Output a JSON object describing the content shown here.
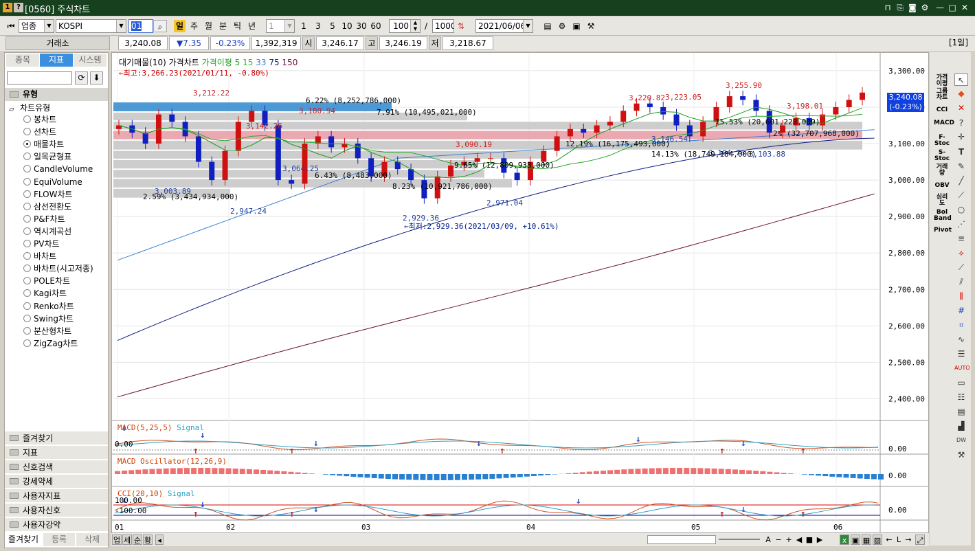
{
  "window": {
    "icon1": "1",
    "icon2": "?",
    "title": "[0560] 주식차트"
  },
  "toolbar": {
    "market_type": "업종",
    "index_name": "KOSPI",
    "code": "01",
    "periods": [
      "일",
      "주",
      "월",
      "분",
      "틱",
      "년"
    ],
    "interval": "1",
    "quick_intervals": [
      "1",
      "3",
      "5",
      "10",
      "30",
      "60"
    ],
    "count": "100",
    "count_sep": "/",
    "total": "1000",
    "date": "2021/06/06"
  },
  "quote": {
    "exchange_btn": "거래소",
    "price": "3,240.08",
    "change": "▼7.35",
    "change_pct": "-0.23%",
    "volume": "1,392,319",
    "open_label": "시",
    "open": "3,246.17",
    "high_label": "고",
    "high": "3,246.19",
    "low_label": "저",
    "low": "3,218.67",
    "period_tag": "[1일]"
  },
  "sidebar": {
    "tabs": [
      "종목",
      "지표",
      "시스템"
    ],
    "section": "유형",
    "tree_root": "차트유형",
    "chart_types": [
      "봉차트",
      "선차트",
      "매물차트",
      "일목균형표",
      "CandleVolume",
      "EquiVolume",
      "FLOW차트",
      "삼선전환도",
      "P&F차트",
      "역시계곡선",
      "PV차트",
      "바차트",
      "바차트(시고저종)",
      "POLE차트",
      "Kagi차트",
      "Renko차트",
      "Swing차트",
      "분산형차트",
      "ZigZag차트"
    ],
    "selected_type": "매물차트",
    "folders": [
      "즐겨찾기",
      "지표",
      "신호검색",
      "강세약세",
      "사용자지표",
      "사용자신호",
      "사용자강약"
    ],
    "bottom_tabs": [
      "즐겨찾기",
      "등록",
      "삭제"
    ]
  },
  "chart": {
    "legend": [
      "대기매물(10)",
      "가격차트",
      "가격이평",
      "5",
      "15",
      "33",
      "75",
      "150"
    ],
    "max_note": "←최고:3,266.23(2021/01/11, -0.80%)",
    "min_note": "←최저:2,929.36(2021/03/09, +10.61%)",
    "y_ticks": [
      "3,300.00",
      "3,200.00",
      "3,100.00",
      "3,000.00",
      "2,900.00",
      "2,800.00",
      "2,700.00",
      "2,600.00",
      "2,500.00",
      "2,400.00"
    ],
    "last_price_tag": "3,240.08",
    "last_change_tag": "(-0.23%)",
    "x_ticks": [
      "01",
      "02",
      "03",
      "04",
      "05",
      "06"
    ],
    "price_labels": [
      "3,212.22",
      "3,180.94",
      "3,142.26",
      "3,090.19",
      "3,220.82",
      "3,223.05",
      "3,255.90",
      "3,198.01",
      "3,064.25",
      "3,003.89",
      "2,947.24",
      "2,929.36",
      "2,971.04",
      "3,146.54",
      "3,103.88",
      "3,104.76"
    ],
    "volume_labels": [
      "6.22% (8,252,786,000)",
      "7.91% (10,495,021,000)",
      "12.19% (16,175,493,000)",
      "14.13% (18,749,184,000)",
      "15.53% (20,601,228,000)",
      "2% (32,707,968,000)",
      "6.43% (8,483,000)",
      "8.23% (10,921,786,000)",
      "9.65% (12,809,933,000)",
      "2.59% (3,434,934,000)"
    ],
    "macd_title": "MACD(5,25,5)",
    "macd_signal": "Signal",
    "macd_zero": "0.00",
    "macd_axis": "0.00",
    "osc_title": "MACD Oscillator(12,26,9)",
    "osc_axis": "0.00",
    "cci_title": "CCI(20,10)",
    "cci_signal": "Signal",
    "cci_100": "100.00",
    "cci_m100": "-100.00",
    "cci_axis": "0.00"
  },
  "chart_data": {
    "type": "candlestick",
    "title": "",
    "ylim": [
      2350,
      3330
    ],
    "x_months": [
      "01",
      "02",
      "03",
      "04",
      "05",
      "06"
    ],
    "series": [
      {
        "name": "가격차트",
        "approx_close": [
          3150,
          3130,
          3100,
          3180,
          3160,
          3120,
          3050,
          3000,
          3080,
          3160,
          3190,
          3150,
          3000,
          2990,
          3100,
          3120,
          3090,
          3100,
          3060,
          3010,
          3050,
          3030,
          3000,
          2950,
          3010,
          3040,
          3050,
          3060,
          3060,
          3020,
          3000,
          3050,
          3080,
          3120,
          3140,
          3130,
          3150,
          3160,
          3190,
          3210,
          3200,
          3180,
          3150,
          3120,
          3160,
          3200,
          3230,
          3220,
          3190,
          3130,
          3150,
          3170,
          3150,
          3180,
          3200,
          3220,
          3240
        ]
      }
    ]
  },
  "righttools": {
    "labels": [
      "가격이평",
      "그룹차트",
      "CCI",
      "MACD",
      "F-Stoc",
      "S-Stoc",
      "거래량",
      "OBV",
      "심리도",
      "Bol Band",
      "Pivot"
    ]
  },
  "bottombar": {
    "tabs": [
      "업",
      "세",
      "순",
      "황"
    ]
  }
}
